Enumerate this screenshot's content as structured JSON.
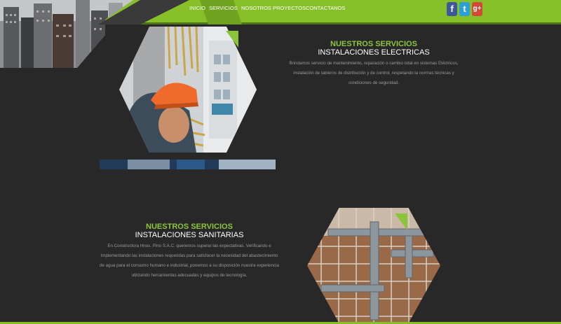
{
  "nav": {
    "items": [
      {
        "label": "INICIO",
        "active": false
      },
      {
        "label": "SERVICIOS",
        "active": true
      },
      {
        "label": "NOSOTROS",
        "active": false
      },
      {
        "label": "PROYECTOS",
        "active": false
      },
      {
        "label": "CONTACTANOS",
        "active": false
      }
    ]
  },
  "social": [
    {
      "glyph": "f",
      "icon": "facebook-icon",
      "color": "#3b5998"
    },
    {
      "glyph": "t",
      "icon": "twitter-icon",
      "color": "#2ba0d6"
    },
    {
      "glyph": "g+",
      "icon": "google-plus-icon",
      "color": "#d34836"
    }
  ],
  "services": [
    {
      "kicker": "NUESTROS SERVICIOS",
      "title": "INSTALACIONES ELECTRICAS",
      "description": "Brindamos servicio de mantenimiento, reparación o cambio total en sistemas Eléctricos, instalación de tableros de distribución y de control, respetando la normas técnicas y condiciones de seguridad."
    },
    {
      "kicker": "NUESTROS SERVICIOS",
      "title": "INSTALACIONES SANITARIAS",
      "description": "En Constructora Hnos. Pino S.A.C. queremos superar las expectativas. Verificando e Implementando las instalaciones requeridas para satisfacer la necesidad del abastecimiento de agua para el consumo humano e industrial, ponemos a su disposición nuestra experiencia utilizando herramientas adecuadas y equipos de tecnología."
    }
  ],
  "colors": {
    "accent": "#86bf28",
    "accent_dark": "#6fa21e",
    "kicker": "#8cc63f",
    "background": "#282828"
  }
}
